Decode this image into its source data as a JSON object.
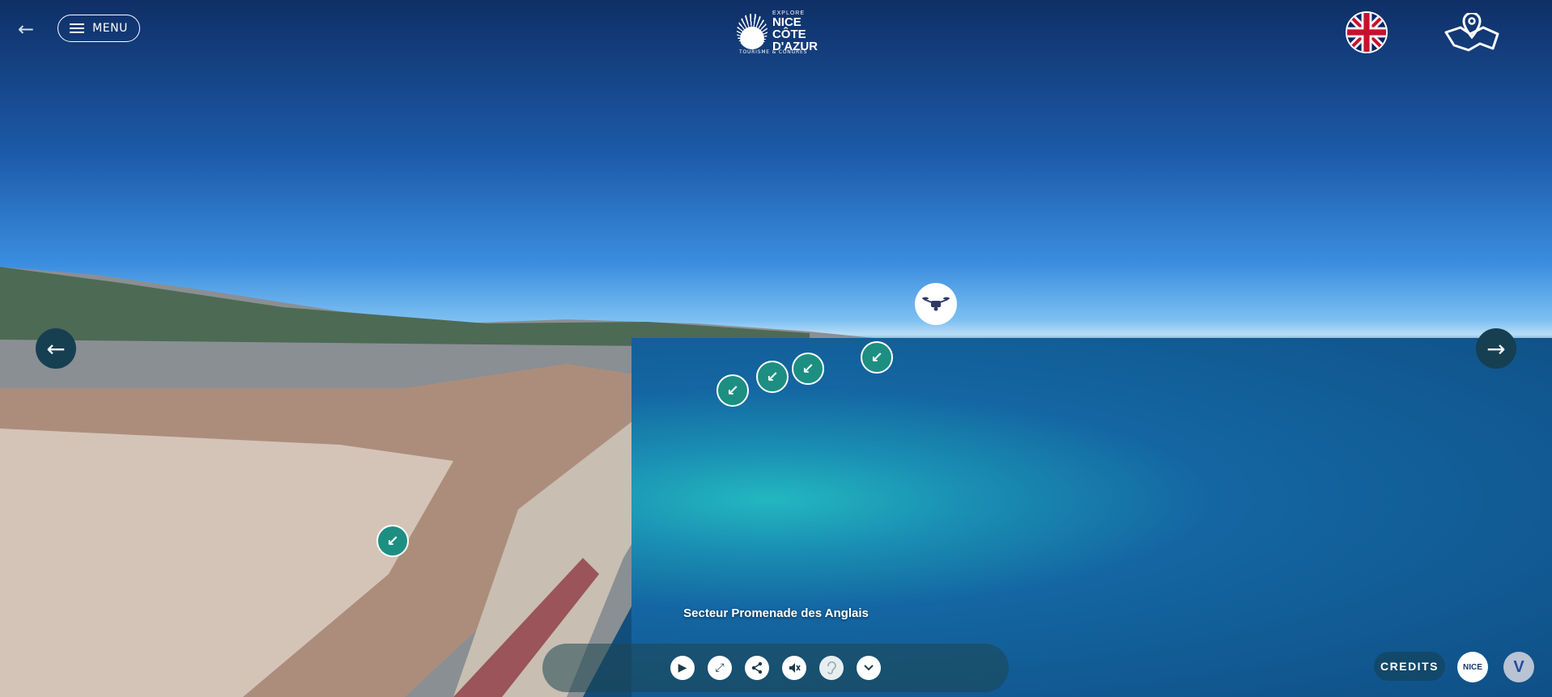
{
  "topbar": {
    "menu_label": "MENU",
    "logo": {
      "explore": "EXPLORE",
      "line1": "NICE",
      "line2": "CÔTE",
      "line3": "D'AZUR",
      "sub": "TOURISME & CONGRÈS"
    }
  },
  "sector_label": "Secteur Promenade des Anglais",
  "credits_label": "CREDITS",
  "badge_nice": "NICE",
  "badge_v": "V",
  "colors": {
    "hotspot": "#1c8f82",
    "nav_arrow": "#163f52"
  }
}
